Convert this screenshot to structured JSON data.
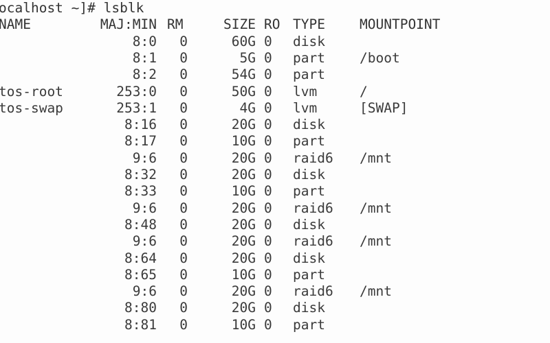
{
  "terminal": {
    "prompt_line": "ocalhost ~]# lsblk",
    "command": "lsblk",
    "background_color": "#fdfdfd",
    "text_color": "#3a3a3a",
    "columns": {
      "name": "NAME",
      "majmin": "MAJ:MIN",
      "rm": "RM",
      "size": "SIZE",
      "ro": "RO",
      "type": "TYPE",
      "mountpoint": "MOUNTPOINT"
    },
    "rows": [
      {
        "name": "",
        "majmin": "8:0",
        "rm": "0",
        "size": "60G",
        "ro": "0",
        "type": "disk",
        "mountpoint": ""
      },
      {
        "name": "",
        "majmin": "8:1",
        "rm": "0",
        "size": "5G",
        "ro": "0",
        "type": "part",
        "mountpoint": "/boot"
      },
      {
        "name": "",
        "majmin": "8:2",
        "rm": "0",
        "size": "54G",
        "ro": "0",
        "type": "part",
        "mountpoint": ""
      },
      {
        "name": "tos-root",
        "majmin": "253:0",
        "rm": "0",
        "size": "50G",
        "ro": "0",
        "type": "lvm",
        "mountpoint": "/"
      },
      {
        "name": "tos-swap",
        "majmin": "253:1",
        "rm": "0",
        "size": "4G",
        "ro": "0",
        "type": "lvm",
        "mountpoint": "[SWAP]"
      },
      {
        "name": "",
        "majmin": "8:16",
        "rm": "0",
        "size": "20G",
        "ro": "0",
        "type": "disk",
        "mountpoint": ""
      },
      {
        "name": "",
        "majmin": "8:17",
        "rm": "0",
        "size": "10G",
        "ro": "0",
        "type": "part",
        "mountpoint": ""
      },
      {
        "name": "",
        "majmin": "9:6",
        "rm": "0",
        "size": "20G",
        "ro": "0",
        "type": "raid6",
        "mountpoint": "/mnt"
      },
      {
        "name": "",
        "majmin": "8:32",
        "rm": "0",
        "size": "20G",
        "ro": "0",
        "type": "disk",
        "mountpoint": ""
      },
      {
        "name": "",
        "majmin": "8:33",
        "rm": "0",
        "size": "10G",
        "ro": "0",
        "type": "part",
        "mountpoint": ""
      },
      {
        "name": "",
        "majmin": "9:6",
        "rm": "0",
        "size": "20G",
        "ro": "0",
        "type": "raid6",
        "mountpoint": "/mnt"
      },
      {
        "name": "",
        "majmin": "8:48",
        "rm": "0",
        "size": "20G",
        "ro": "0",
        "type": "disk",
        "mountpoint": ""
      },
      {
        "name": "",
        "majmin": "9:6",
        "rm": "0",
        "size": "20G",
        "ro": "0",
        "type": "raid6",
        "mountpoint": "/mnt"
      },
      {
        "name": "",
        "majmin": "8:64",
        "rm": "0",
        "size": "20G",
        "ro": "0",
        "type": "disk",
        "mountpoint": ""
      },
      {
        "name": "",
        "majmin": "8:65",
        "rm": "0",
        "size": "10G",
        "ro": "0",
        "type": "part",
        "mountpoint": ""
      },
      {
        "name": "",
        "majmin": "9:6",
        "rm": "0",
        "size": "20G",
        "ro": "0",
        "type": "raid6",
        "mountpoint": "/mnt"
      },
      {
        "name": "",
        "majmin": "8:80",
        "rm": "0",
        "size": "20G",
        "ro": "0",
        "type": "disk",
        "mountpoint": ""
      },
      {
        "name": "",
        "majmin": "8:81",
        "rm": "0",
        "size": "10G",
        "ro": "0",
        "type": "part",
        "mountpoint": ""
      }
    ]
  }
}
